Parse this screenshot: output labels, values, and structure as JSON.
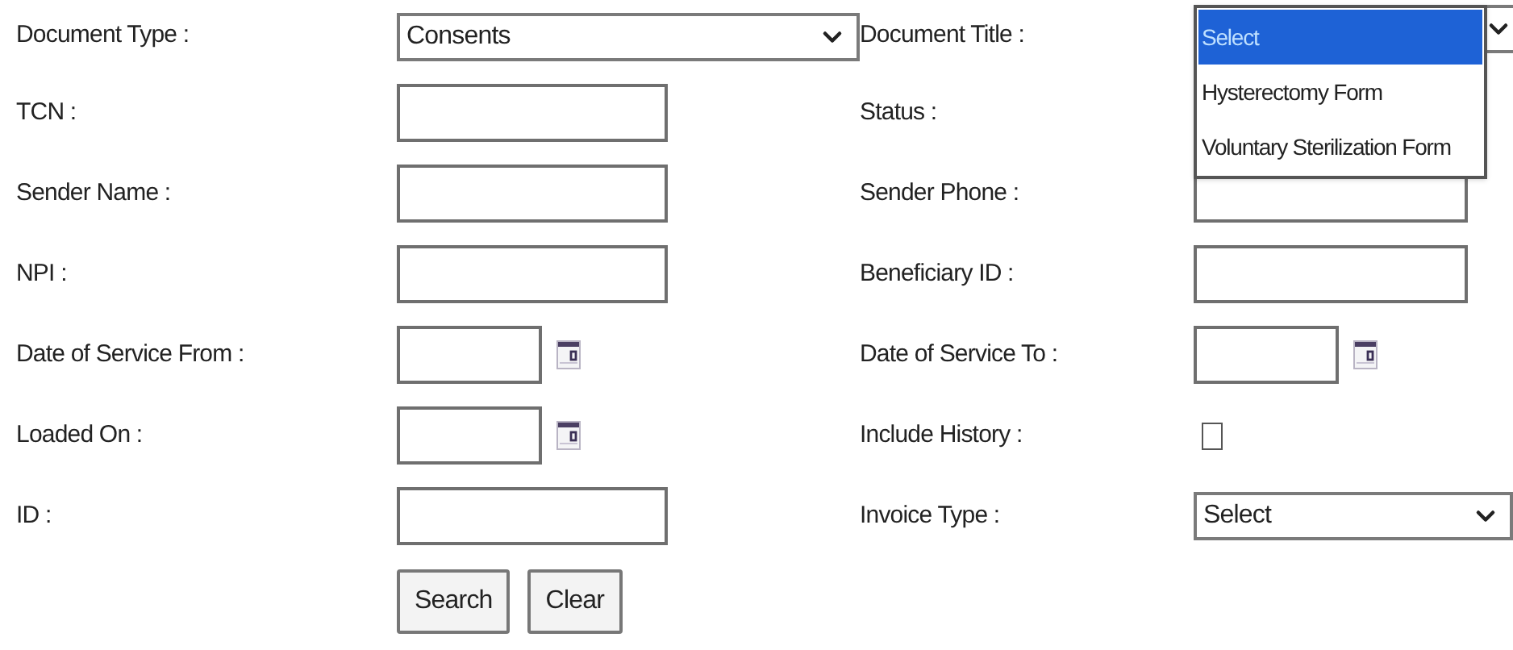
{
  "left_fields": [
    {
      "label": "Document Type :",
      "kind": "select",
      "value": "Consents"
    },
    {
      "label": "TCN :",
      "kind": "text"
    },
    {
      "label": "Sender Name :",
      "kind": "text"
    },
    {
      "label": "NPI :",
      "kind": "text"
    },
    {
      "label": "Date of Service From :",
      "kind": "date"
    },
    {
      "label": "Loaded On :",
      "kind": "date"
    },
    {
      "label": "ID :",
      "kind": "text"
    }
  ],
  "right_fields": [
    {
      "label": "Document Title :",
      "kind": "open_select",
      "options": [
        {
          "label": "Select",
          "selected": true
        },
        {
          "label": "Hysterectomy Form",
          "selected": false
        },
        {
          "label": "Voluntary Sterilization Form",
          "selected": false
        }
      ]
    },
    {
      "label": "Status :",
      "kind": "covered"
    },
    {
      "label": "Sender Phone :",
      "kind": "text"
    },
    {
      "label": "Beneficiary ID :",
      "kind": "text"
    },
    {
      "label": "Date of Service To :",
      "kind": "date"
    },
    {
      "label": "Include History :",
      "kind": "checkbox",
      "checked": false
    },
    {
      "label": "Invoice Type :",
      "kind": "select",
      "value": "Select"
    }
  ],
  "buttons": [
    "Search",
    "Clear"
  ]
}
